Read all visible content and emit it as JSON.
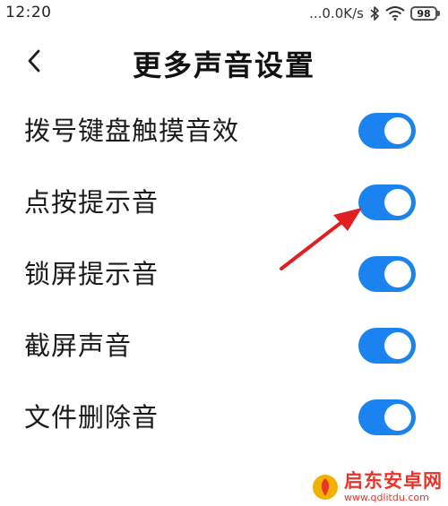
{
  "status_bar": {
    "time": "12:20",
    "network_speed": "...0.0K/s",
    "battery_level": "98",
    "icons": [
      "bluetooth-icon",
      "wifi-icon",
      "battery-icon"
    ]
  },
  "header": {
    "back_icon": "chevron-left-icon",
    "title": "更多声音设置"
  },
  "settings": [
    {
      "label": "拨号键盘触摸音效",
      "enabled": true
    },
    {
      "label": "点按提示音",
      "enabled": true
    },
    {
      "label": "锁屏提示音",
      "enabled": true
    },
    {
      "label": "截屏声音",
      "enabled": true
    },
    {
      "label": "文件删除音",
      "enabled": true
    }
  ],
  "colors": {
    "toggle_on": "#1a83f0",
    "arrow": "#e02020",
    "watermark": "#e8342a"
  },
  "watermark": {
    "title": "启东安卓网",
    "url": "www.qdlitdu.com"
  }
}
